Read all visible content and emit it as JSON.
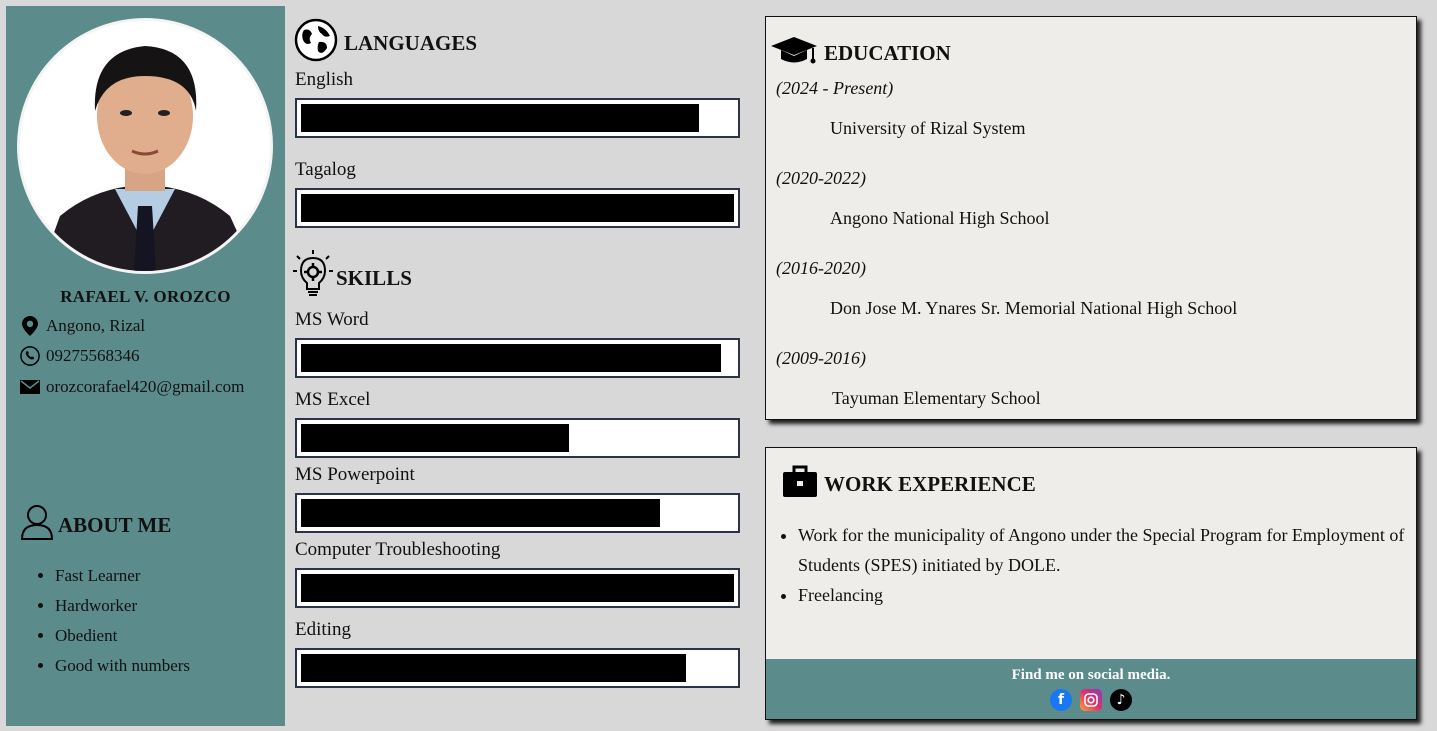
{
  "profile": {
    "name": "RAFAEL V. OROZCO",
    "location": "Angono, Rizal",
    "phone": "09275568346",
    "email": "orozcorafael420@gmail.com"
  },
  "about": {
    "title": "ABOUT ME",
    "items": [
      "Fast Learner",
      "Hardworker",
      "Obedient",
      "Good with numbers"
    ]
  },
  "languages": {
    "title": "LANGUAGES",
    "items": [
      {
        "label": "English",
        "level": 0.92
      },
      {
        "label": "Tagalog",
        "level": 1.0
      }
    ]
  },
  "skills": {
    "title": "SKILLS",
    "items": [
      {
        "label": "MS Word",
        "level": 0.97
      },
      {
        "label": "MS Excel",
        "level": 0.62
      },
      {
        "label": "MS Powerpoint",
        "level": 0.83
      },
      {
        "label": "Computer Troubleshooting",
        "level": 1.0
      },
      {
        "label": "Editing",
        "level": 0.89
      }
    ]
  },
  "education": {
    "title": "EDUCATION",
    "entries": [
      {
        "years": "(2024 - Present)",
        "school": "University of Rizal System"
      },
      {
        "years": "(2020-2022)",
        "school": "Angono National High School"
      },
      {
        "years": "(2016-2020)",
        "school": "Don Jose M. Ynares Sr. Memorial National High School"
      },
      {
        "years": "(2009-2016)",
        "school": "Tayuman Elementary School"
      }
    ]
  },
  "work": {
    "title": "WORK EXPERIENCE",
    "items": [
      "Work for the municipality of Angono under the Special Program for Employment of Students (SPES) initiated by DOLE.",
      "Freelancing"
    ]
  },
  "footer": {
    "text": "Find me on social media.",
    "socials": [
      "facebook-icon",
      "instagram-icon",
      "tiktok-icon"
    ]
  },
  "colors": {
    "sidebar": "#5c8b8c",
    "page_bg": "#d9d8d9",
    "panel_bg": "#eeede9",
    "bar_border": "#2a3449",
    "bar_fill": "#000000"
  }
}
